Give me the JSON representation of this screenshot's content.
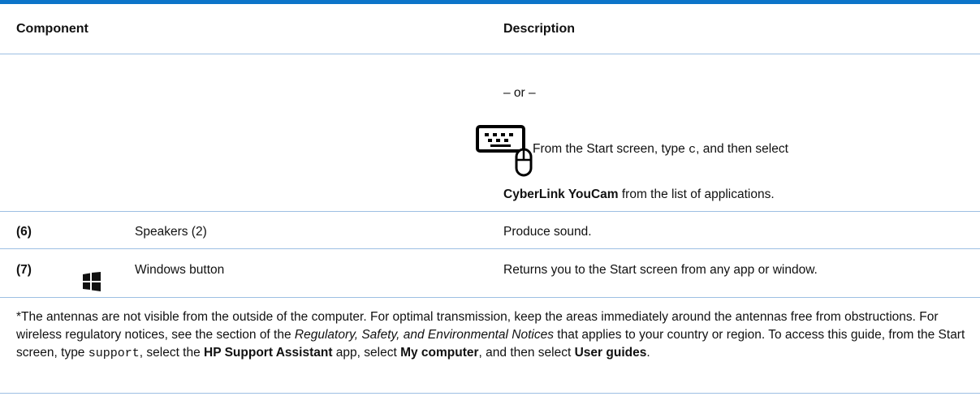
{
  "table": {
    "header": {
      "component": "Component",
      "description": "Description"
    },
    "continuation": {
      "or_text": "– or –",
      "instruction_prefix": "From the Start screen, type ",
      "typed_char": "c",
      "instruction_suffix": ", and then select",
      "app_name": "CyberLink YouCam",
      "app_suffix": " from the list of applications."
    },
    "rows": [
      {
        "number": "(6)",
        "component": "Speakers (2)",
        "description": "Produce sound."
      },
      {
        "number": "(7)",
        "component": "Windows button",
        "description": "Returns you to the Start screen from any app or window."
      }
    ]
  },
  "footnote": {
    "part1": "*The antennas are not visible from the outside of the computer. For optimal transmission, keep the areas immediately around the antennas free from obstructions. For wireless regulatory notices, see the section of the ",
    "doc_title": "Regulatory, Safety, and Environmental Notices",
    "part2": " that applies to your country or region. To access this guide, from the Start screen, type ",
    "typed_word": "support",
    "part3": ", select the ",
    "app_name": "HP Support Assistant",
    "part4": " app, select ",
    "my_computer": "My computer",
    "part5": ", and then select ",
    "user_guides": "User guides",
    "part6": "."
  },
  "colors": {
    "accent_rule": "#0c74c9",
    "row_divider": "#9dbfe3"
  },
  "icons": [
    "keyboard-mouse-icon",
    "windows-logo-icon"
  ]
}
